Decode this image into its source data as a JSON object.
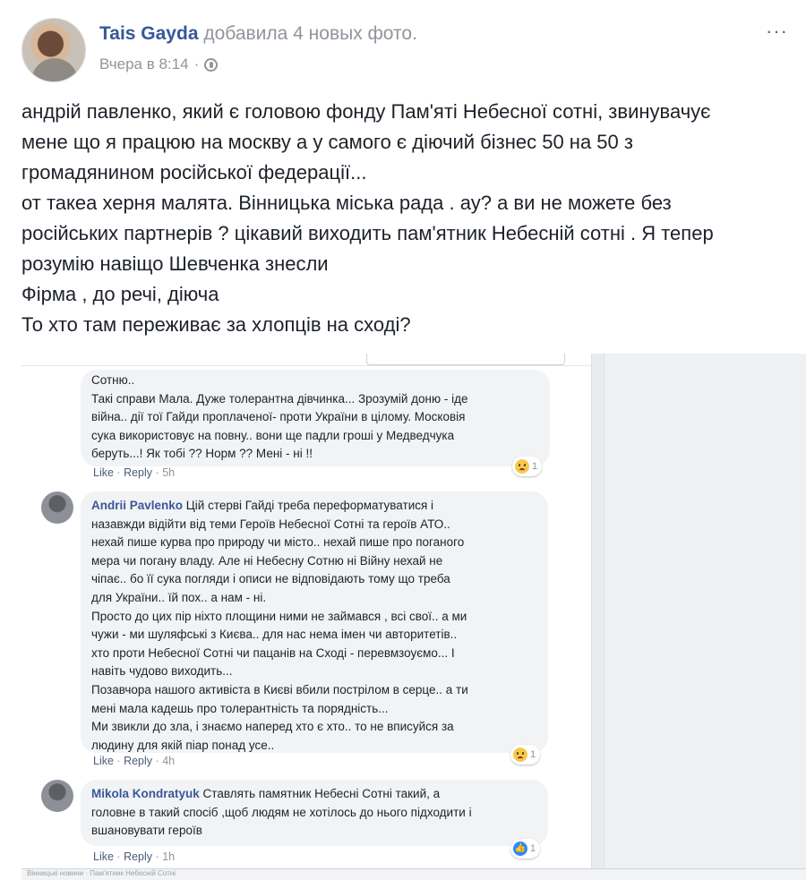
{
  "post": {
    "author": "Tais Gayda",
    "action": "добавила 4 новых фото.",
    "time": "Вчера в 8:14",
    "separator": "·",
    "more": "···",
    "text_lines": [
      "андрій павленко, який є головою фонду Пам'яті Небесної сотні, звинувачує",
      "мене що я працюю на москву а у самого є діючий бізнес 50 на 50 з",
      "громадянином російської федерації...",
      "от такеа херня малята. Вінницька міська рада . ау? а ви не можете без",
      "російських партнерів ? цікавий виходить пам'ятник Небесній сотні . Я тепер",
      "розумію навіщо Шевченка знесли",
      "Фірма , до речі, діюча",
      "То хто там переживає за хлопців на сході?"
    ]
  },
  "photo": {
    "comments": [
      {
        "name": "",
        "lines": [
          "Сотню..",
          "Такі справи Мала. Дуже толерантна дівчинка... Зрозумій доню - іде",
          "війна.. дії тої Гайди проплаченої- проти України в цілому. Московія",
          "сука використовує на повну.. вони ще падли гроші у Медведчука",
          "беруть...! Як тобі ?? Норм ?? Мені - ні !!"
        ],
        "like": "Like",
        "reply": "Reply",
        "time": "5h",
        "reaction_icon": "sad-icon",
        "reaction_count": "1"
      },
      {
        "name": "Andrii Pavlenko",
        "lines": [
          "Цій стерві Гайді треба переформатуватися і",
          "назавжди відійти від теми Героїв Небесної Сотні та героїв АТО..",
          "нехай пише курва про природу чи місто.. нехай пише про поганого",
          "мера чи погану владу. Але ні Небесну Сотню ні Війну нехай не",
          "чіпає.. бо її сука погляди і описи не відповідають тому що треба",
          "для України.. їй пох.. а нам - ні.",
          "Просто до цих пір ніхто площини ними не займався , всі свої.. а ми",
          "чужи - ми шуляфські з Києва.. для нас нема імен чи авторитетів..",
          "хто проти Небесної Сотні чи пацанів на Сході - перевмзоуємо... І",
          "навіть чудово виходить...",
          "Позавчора нашого активіста в Києві вбили пострілом в серце.. а ти",
          "мені мала кадешь про толерантність та порядність...",
          "Ми звикли до зла, і знаємо наперед хто є хто.. то не вписуйся за",
          "людину для якій піар понад усе.."
        ],
        "like": "Like",
        "reply": "Reply",
        "time": "4h",
        "reaction_icon": "sad-icon",
        "reaction_count": "1"
      },
      {
        "name": "Mikola Kondratyuk",
        "lines": [
          "Ставлять памятник Небесні Сотні такий, а",
          "головне в такий спосіб ,щоб людям не хотілось до нього підходити і",
          "вшановувати героїв"
        ],
        "like": "Like",
        "reply": "Reply",
        "time": "1h",
        "reaction_icon": "like-icon",
        "reaction_count": "1"
      }
    ],
    "dot": "·",
    "footer_text": "Вінницькі новини · Пам'ятник Небесній Сотні"
  }
}
